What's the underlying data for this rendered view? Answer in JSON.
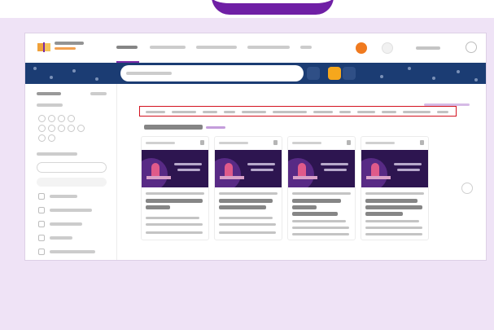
{
  "theme": {
    "accent": "#7a2aa6",
    "title_purple": "#6f1fa5",
    "page_bg": "#efe3f6",
    "banner": "#1b3c73",
    "orange": "#f07a1f",
    "highlight": "#d3121f"
  },
  "icons": {
    "logo": "book-icon",
    "notifications": "bell-icon",
    "help": "question-icon",
    "search": "search-icon",
    "grid": "grid-icon",
    "favorite": "bookmark-icon",
    "next": "chevron-right-icon"
  },
  "main": {
    "section_title": "МЭШ-инструкции"
  }
}
